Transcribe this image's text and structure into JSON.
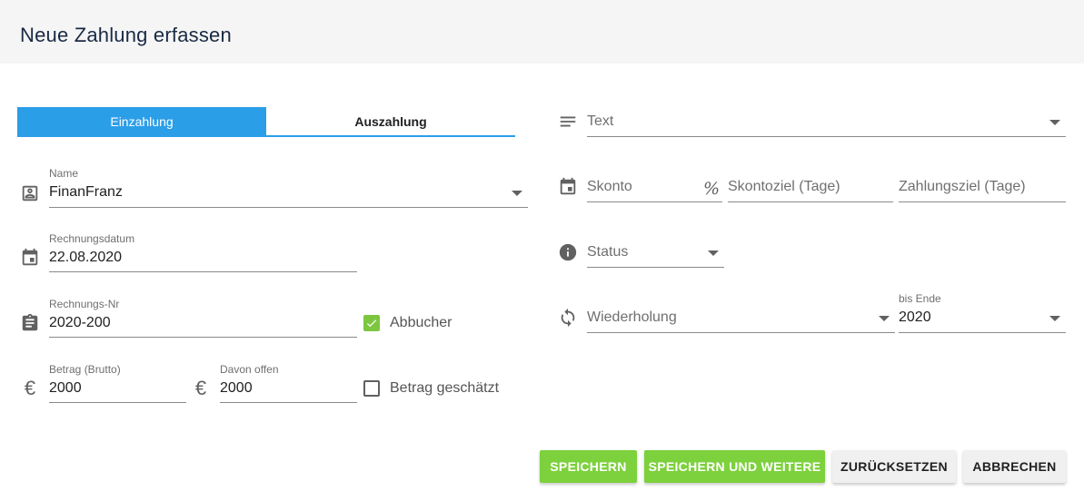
{
  "header": {
    "title": "Neue Zahlung erfassen"
  },
  "tabs": [
    {
      "label": "Einzahlung",
      "active": true
    },
    {
      "label": "Auszahlung",
      "active": false
    }
  ],
  "left": {
    "name": {
      "label": "Name",
      "value": "FinanFranz"
    },
    "rechnungsdatum": {
      "label": "Rechnungsdatum",
      "value": "22.08.2020"
    },
    "rechnungsnr": {
      "label": "Rechnungs-Nr",
      "value": "2020-200"
    },
    "abbucher": {
      "label": "Abbucher",
      "checked": true
    },
    "betrag": {
      "label": "Betrag (Brutto)",
      "value": "2000"
    },
    "davon_offen": {
      "label": "Davon offen",
      "value": "2000"
    },
    "betrag_geschaetzt": {
      "label": "Betrag geschätzt",
      "checked": false
    },
    "currency_symbol": "€"
  },
  "right": {
    "text": {
      "placeholder": "Text"
    },
    "skonto": {
      "placeholder": "Skonto",
      "suffix": "%"
    },
    "skontoziel": {
      "placeholder": "Skontoziel (Tage)"
    },
    "zahlungsziel": {
      "placeholder": "Zahlungsziel (Tage)"
    },
    "status": {
      "placeholder": "Status"
    },
    "wiederholung": {
      "placeholder": "Wiederholung"
    },
    "bis_ende": {
      "label": "bis Ende",
      "value": "2020"
    }
  },
  "buttons": {
    "save": "SPEICHERN",
    "save_more": "SPEICHERN UND WEITERE",
    "reset": "ZURÜCKSETZEN",
    "cancel": "ABBRECHEN"
  },
  "colors": {
    "accent_blue": "#2b9ee8",
    "accent_green": "#7dd13d",
    "checkbox_green": "#7dc640"
  },
  "icons": {
    "text_field": "notes-icon",
    "name_field": "contact-card-icon",
    "date_field": "calendar-icon",
    "skonto_field": "calendar-icon",
    "rechnungsnr_field": "clipboard-icon",
    "status_field": "info-icon",
    "betrag_field": "euro-icon",
    "wiederholung_field": "sync-icon"
  }
}
